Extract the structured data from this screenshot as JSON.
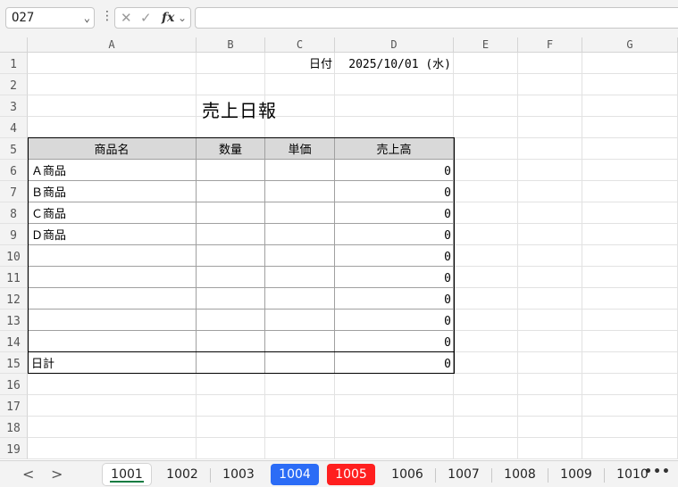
{
  "formula_bar": {
    "name_box": "O27",
    "menu_dots": "⋮",
    "cancel_glyph": "✕",
    "enter_glyph": "✓",
    "fx_label": "fx",
    "dropdown_glyph": "⌄",
    "formula_value": ""
  },
  "columns": [
    "A",
    "B",
    "C",
    "D",
    "E",
    "F",
    "G"
  ],
  "rows": [
    "1",
    "2",
    "3",
    "4",
    "5",
    "6",
    "7",
    "8",
    "9",
    "10",
    "11",
    "12",
    "13",
    "14",
    "15",
    "16",
    "17",
    "18",
    "19"
  ],
  "sheet": {
    "date_label": "日付",
    "date_value": "2025/10/01 (水)",
    "title": "売上日報",
    "headers": [
      "商品名",
      "数量",
      "単価",
      "売上高"
    ],
    "items": [
      {
        "name": "Ａ商品",
        "qty": "",
        "price": "",
        "sales": "0"
      },
      {
        "name": "Ｂ商品",
        "qty": "",
        "price": "",
        "sales": "0"
      },
      {
        "name": "Ｃ商品",
        "qty": "",
        "price": "",
        "sales": "0"
      },
      {
        "name": "Ｄ商品",
        "qty": "",
        "price": "",
        "sales": "0"
      },
      {
        "name": "",
        "qty": "",
        "price": "",
        "sales": "0"
      },
      {
        "name": "",
        "qty": "",
        "price": "",
        "sales": "0"
      },
      {
        "name": "",
        "qty": "",
        "price": "",
        "sales": "0"
      },
      {
        "name": "",
        "qty": "",
        "price": "",
        "sales": "0"
      },
      {
        "name": "",
        "qty": "",
        "price": "",
        "sales": "0"
      }
    ],
    "total_label": "日計",
    "total_value": "0"
  },
  "tabs": {
    "prev_glyph": "<",
    "next_glyph": ">",
    "more_glyph": "•••",
    "active": "1001",
    "items": [
      {
        "label": "1001",
        "color": ""
      },
      {
        "label": "1002",
        "color": ""
      },
      {
        "label": "1003",
        "color": ""
      },
      {
        "label": "1004",
        "color": "#2b6cf6"
      },
      {
        "label": "1005",
        "color": "#ff1f1f"
      },
      {
        "label": "1006",
        "color": ""
      },
      {
        "label": "1007",
        "color": ""
      },
      {
        "label": "1008",
        "color": ""
      },
      {
        "label": "1009",
        "color": ""
      },
      {
        "label": "1010",
        "color": ""
      }
    ]
  }
}
